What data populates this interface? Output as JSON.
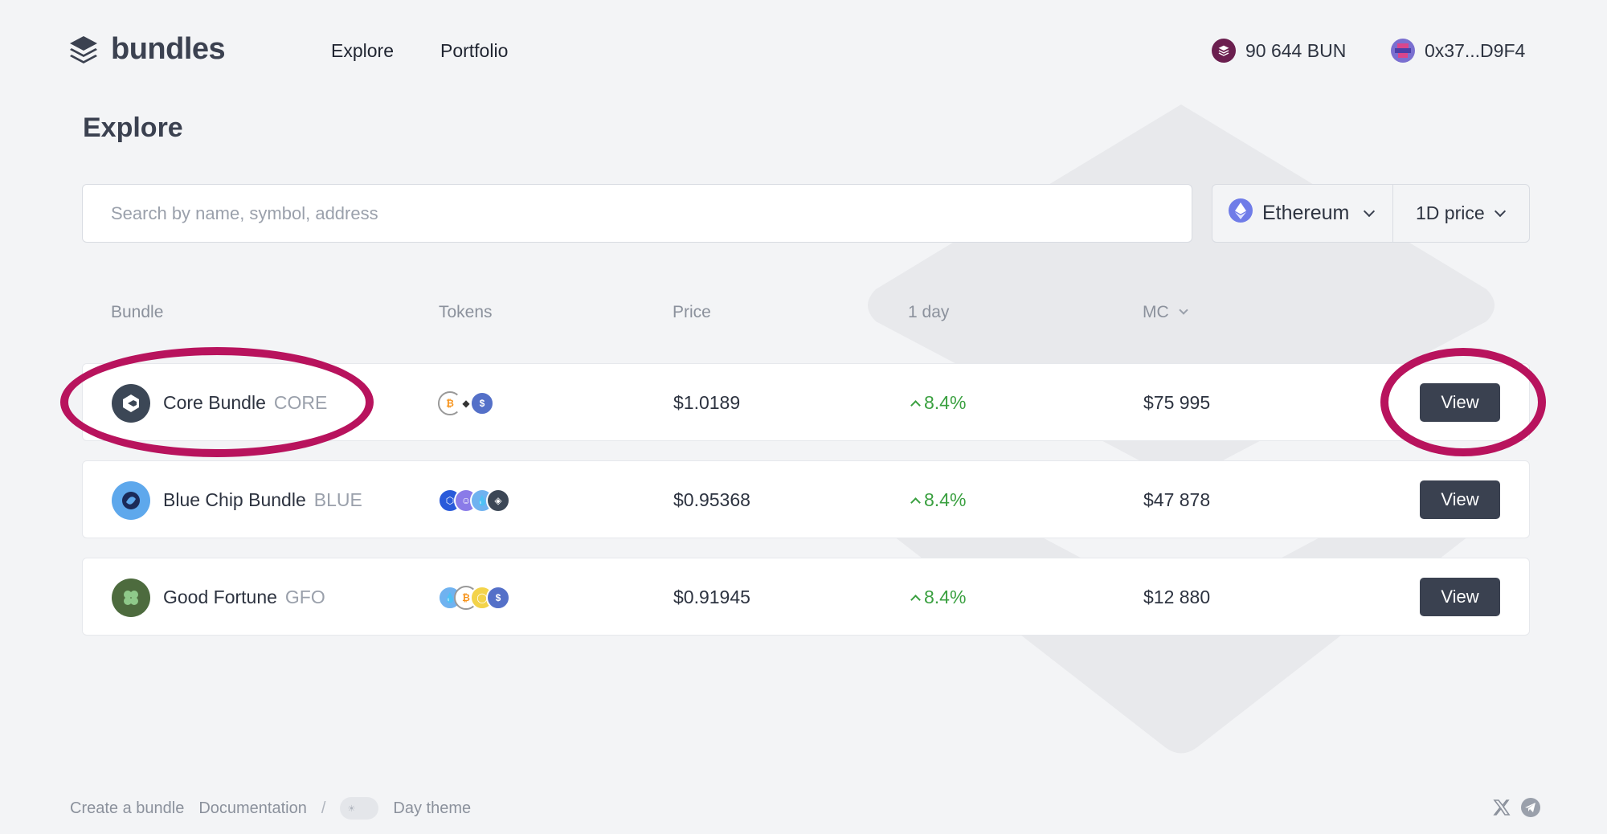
{
  "header": {
    "logo_text": "bundles",
    "nav": [
      "Explore",
      "Portfolio"
    ],
    "balance": "90 644 BUN",
    "address": "0x37...D9F4"
  },
  "page_title": "Explore",
  "search": {
    "placeholder": "Search by name, symbol, address"
  },
  "filters": {
    "network": "Ethereum",
    "price_period": "1D price"
  },
  "table": {
    "headers": [
      "Bundle",
      "Tokens",
      "Price",
      "1 day",
      "MC"
    ],
    "rows": [
      {
        "name": "Core Bundle",
        "symbol": "CORE",
        "price": "$1.0189",
        "change": "8.4%",
        "mc": "$75 995",
        "action": "View"
      },
      {
        "name": "Blue Chip Bundle",
        "symbol": "BLUE",
        "price": "$0.95368",
        "change": "8.4%",
        "mc": "$47 878",
        "action": "View"
      },
      {
        "name": "Good Fortune",
        "symbol": "GFO",
        "price": "$0.91945",
        "change": "8.4%",
        "mc": "$12 880",
        "action": "View"
      }
    ]
  },
  "footer": {
    "create": "Create a bundle",
    "docs": "Documentation",
    "sep": "/",
    "theme": "Day theme"
  },
  "colors": {
    "highlight": "#b8135d",
    "positive": "#3aa040",
    "button": "#3a4150",
    "background": "#f3f4f6"
  },
  "icons": [
    "layers-logo-icon",
    "bun-token-icon",
    "avatar-icon",
    "ethereum-icon",
    "chevron-down-icon",
    "arrow-up-icon",
    "sun-icon",
    "x-twitter-icon",
    "telegram-icon"
  ]
}
